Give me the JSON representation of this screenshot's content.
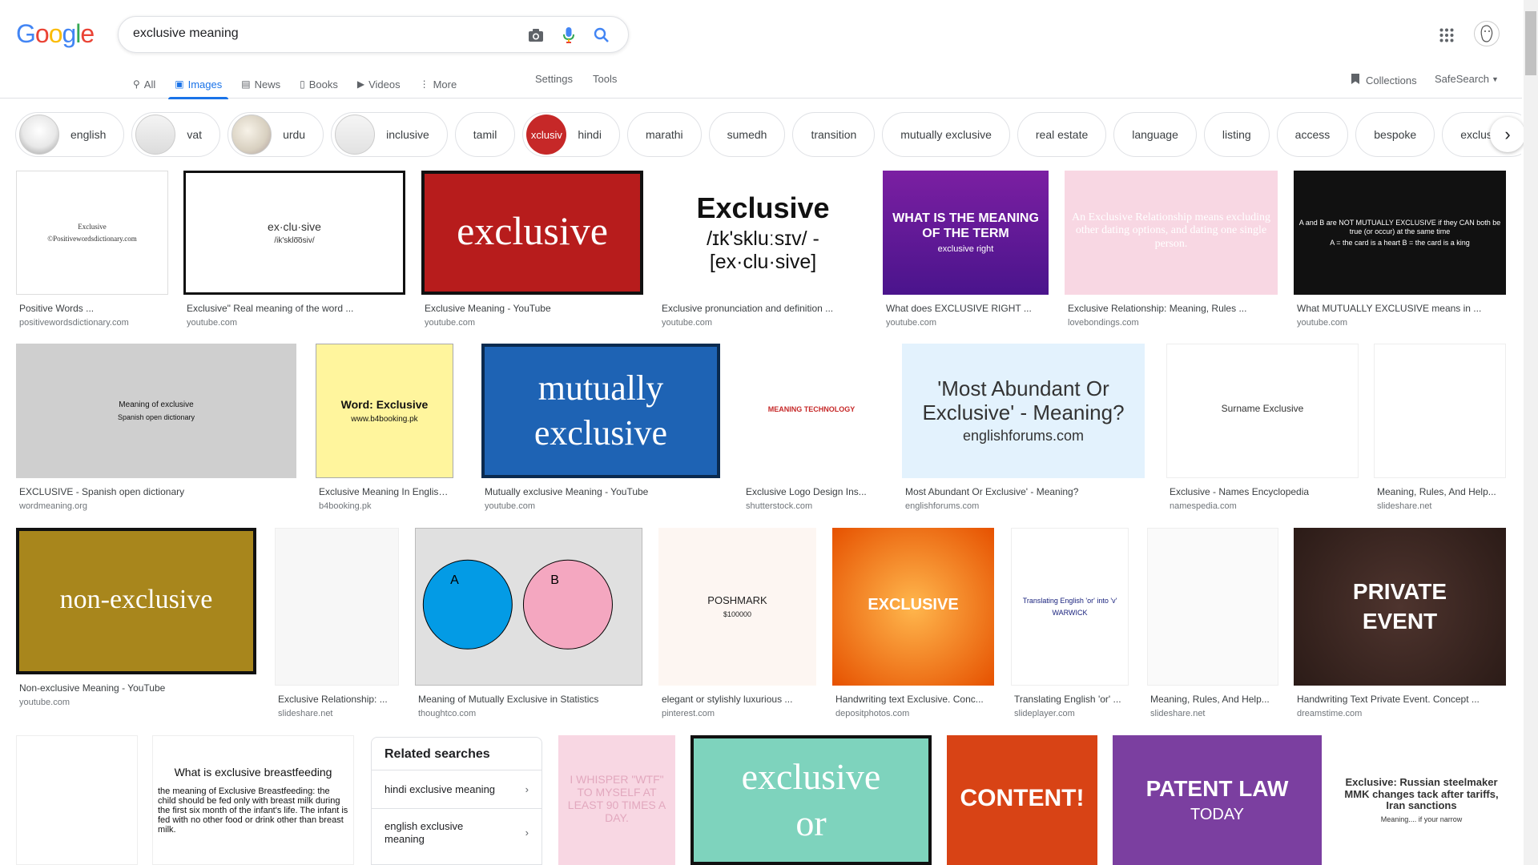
{
  "logo": [
    "G",
    "o",
    "o",
    "g",
    "l",
    "e"
  ],
  "logo_colors": [
    "#4285f4",
    "#ea4335",
    "#fbbc05",
    "#4285f4",
    "#34a853",
    "#ea4335"
  ],
  "search": {
    "value": "exclusive meaning"
  },
  "tabs": [
    {
      "label": "All",
      "icon": "search-icon"
    },
    {
      "label": "Images",
      "icon": "image-icon"
    },
    {
      "label": "News",
      "icon": "news-icon"
    },
    {
      "label": "Books",
      "icon": "book-icon"
    },
    {
      "label": "Videos",
      "icon": "video-icon"
    },
    {
      "label": "More",
      "icon": "more-vert-icon"
    }
  ],
  "settings_label": "Settings",
  "tools_label": "Tools",
  "collections_label": "Collections",
  "safesearch_label": "SafeSearch",
  "chips": [
    {
      "label": "english",
      "thumb": true
    },
    {
      "label": "vat",
      "thumb": true
    },
    {
      "label": "urdu",
      "thumb": true
    },
    {
      "label": "inclusive",
      "thumb": true
    },
    {
      "label": "tamil",
      "thumb": false
    },
    {
      "label": "hindi",
      "thumb": true,
      "thumb_text": "xclusiv"
    },
    {
      "label": "marathi",
      "thumb": false
    },
    {
      "label": "sumedh",
      "thumb": false
    },
    {
      "label": "transition",
      "thumb": false
    },
    {
      "label": "mutually exclusive",
      "thumb": false
    },
    {
      "label": "real estate",
      "thumb": false
    },
    {
      "label": "language",
      "thumb": false
    },
    {
      "label": "listing",
      "thumb": false
    },
    {
      "label": "access",
      "thumb": false
    },
    {
      "label": "bespoke",
      "thumb": false
    },
    {
      "label": "exclusively",
      "thumb": false
    }
  ],
  "results": [
    {
      "caption": "Positive Words ...",
      "domain": "positivewordsdictionary.com",
      "img_text": "Exclusive",
      "img_sub": "©Positivewordsdictionary.com"
    },
    {
      "caption": "Exclusive\" Real meaning of the word ...",
      "domain": "youtube.com",
      "img_text": "ex·clu·sive",
      "img_sub": "/ik'sklo͞osiv/"
    },
    {
      "caption": "Exclusive Meaning - YouTube",
      "domain": "youtube.com",
      "img_text": "exclusive",
      "img_sub": ""
    },
    {
      "caption": "Exclusive pronunciation and definition ...",
      "domain": "youtube.com",
      "img_text": "Exclusive",
      "img_sub": "/ɪk'skluːsɪv/ - [ex·clu·sive]"
    },
    {
      "caption": "What does EXCLUSIVE RIGHT ...",
      "domain": "youtube.com",
      "img_text": "WHAT IS THE MEANING OF THE TERM",
      "img_sub": "exclusive right"
    },
    {
      "caption": "Exclusive Relationship: Meaning, Rules ...",
      "domain": "lovebondings.com",
      "img_text": "An Exclusive Relationship means excluding other dating options, and dating one single person.",
      "img_sub": ""
    },
    {
      "caption": "What MUTUALLY EXCLUSIVE means in ...",
      "domain": "youtube.com",
      "img_text": "A and B are NOT MUTUALLY EXCLUSIVE if they CAN both be true (or occur) at the same time",
      "img_sub": "A = the card is a heart  B = the card is a king"
    },
    {
      "caption": "EXCLUSIVE - Spanish open dictionary",
      "domain": "wordmeaning.org",
      "img_text": "Meaning of exclusive",
      "img_sub": "Spanish open dictionary"
    },
    {
      "caption": "Exclusive Meaning In English ...",
      "domain": "b4booking.pk",
      "img_text": "Word: Exclusive",
      "img_sub": "www.b4booking.pk"
    },
    {
      "caption": "Mutually exclusive Meaning - YouTube",
      "domain": "youtube.com",
      "img_text": "mutually",
      "img_sub": "exclusive"
    },
    {
      "caption": "Exclusive Logo Design Ins...",
      "domain": "shutterstock.com",
      "img_text": "MEANING TECHNOLOGY",
      "img_sub": ""
    },
    {
      "caption": "Most Abundant Or Exclusive' - Meaning?",
      "domain": "englishforums.com",
      "img_text": "'Most Abundant Or Exclusive' - Meaning?",
      "img_sub": "englishforums.com"
    },
    {
      "caption": "Exclusive - Names Encyclopedia",
      "domain": "namespedia.com",
      "img_text": "Surname Exclusive",
      "img_sub": ""
    },
    {
      "caption": "Meaning, Rules, And Help...",
      "domain": "slideshare.net",
      "img_text": "",
      "img_sub": ""
    },
    {
      "caption": "Non-exclusive Meaning - YouTube",
      "domain": "youtube.com",
      "img_text": "non-exclusive",
      "img_sub": ""
    },
    {
      "caption": "Exclusive Relationship: ...",
      "domain": "slideshare.net",
      "img_text": "",
      "img_sub": ""
    },
    {
      "caption": "Meaning of Mutually Exclusive in Statistics",
      "domain": "thoughtco.com",
      "img_text": "A",
      "img_sub": "B"
    },
    {
      "caption": "elegant or stylishly luxurious ...",
      "domain": "pinterest.com",
      "img_text": "POSHMARK",
      "img_sub": "$100000"
    },
    {
      "caption": "Handwriting text Exclusive. Conc...",
      "domain": "depositphotos.com",
      "img_text": "EXCLUSIVE",
      "img_sub": ""
    },
    {
      "caption": "Translating English 'or' ...",
      "domain": "slideplayer.com",
      "img_text": "Translating English 'or' into 'v'",
      "img_sub": "WARWICK"
    },
    {
      "caption": "Meaning, Rules, And Help...",
      "domain": "slideshare.net",
      "img_text": "",
      "img_sub": ""
    },
    {
      "caption": "Handwriting Text Private Event. Concept ...",
      "domain": "dreamstime.com",
      "img_text": "PRIVATE",
      "img_sub": "EVENT"
    },
    {
      "caption": "",
      "domain": "",
      "img_text": "",
      "img_sub": ""
    },
    {
      "caption": "",
      "domain": "",
      "img_text": "What is exclusive breastfeeding",
      "img_sub": "the meaning of Exclusive Breastfeeding: the child should be fed only with breast milk during the first six month of the infant's life. The infant is fed with no other food or drink other than breast milk."
    },
    {
      "caption": "",
      "domain": "",
      "img_text": "I WHISPER \"WTF\" TO MYSELF AT LEAST 90 TIMES A DAY.",
      "img_sub": ""
    },
    {
      "caption": "",
      "domain": "",
      "img_text": "exclusive",
      "img_sub": "or"
    },
    {
      "caption": "",
      "domain": "",
      "img_text": "CONTENT!",
      "img_sub": ""
    },
    {
      "caption": "",
      "domain": "",
      "img_text": "PATENT LAW",
      "img_sub": "TODAY"
    },
    {
      "caption": "",
      "domain": "",
      "img_text": "Exclusive: Russian steelmaker MMK changes tack after tariffs, Iran sanctions",
      "img_sub": "Meaning.... if your narrow"
    }
  ],
  "related": {
    "title": "Related searches",
    "items": [
      "hindi exclusive meaning",
      "english exclusive meaning"
    ]
  }
}
